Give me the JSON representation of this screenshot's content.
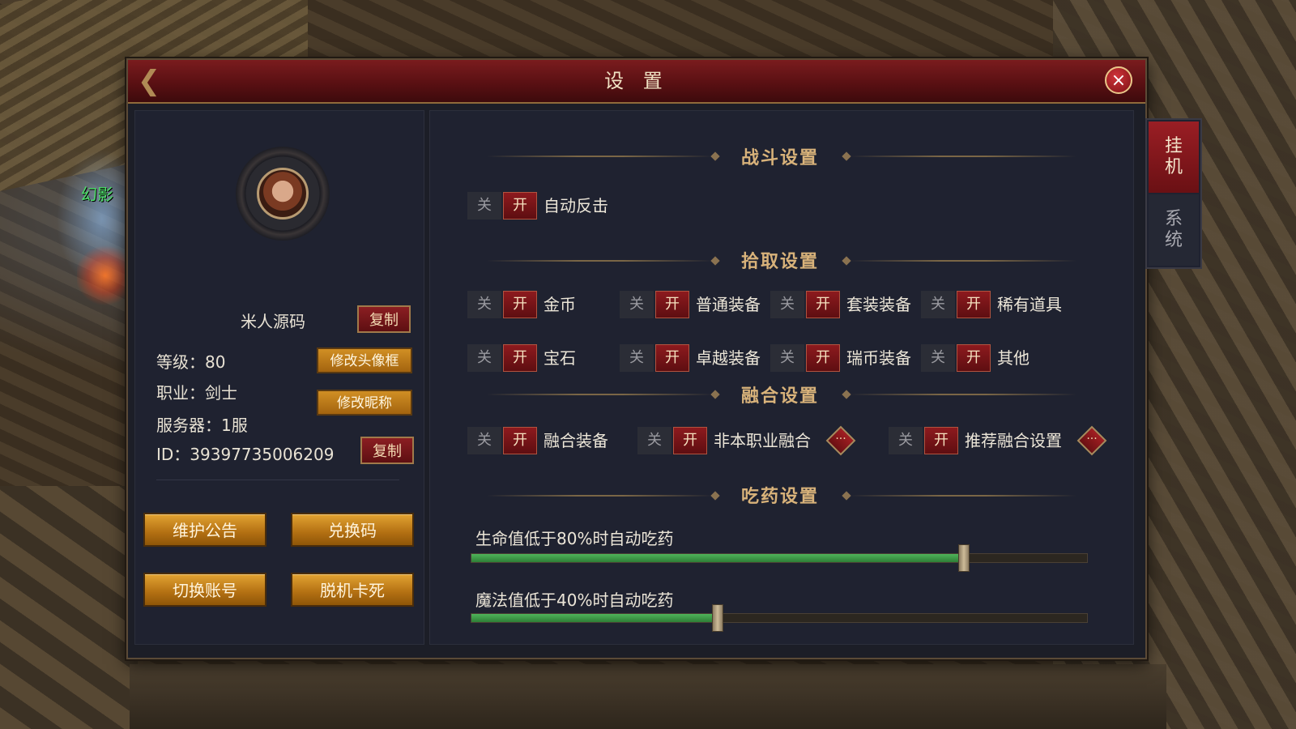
{
  "world": {
    "npc_label": "幻影"
  },
  "dialog": {
    "title": "设 置",
    "close_icon": "×"
  },
  "profile": {
    "name": "米人源码",
    "copy_name_label": "复制",
    "level_text": "等级：80",
    "class_text": "职业：剑士",
    "server_text": "服务器：1服",
    "id_text": "ID：39397735006209",
    "copy_id_label": "复制",
    "edit_frame_label": "修改头像框",
    "edit_nickname_label": "修改昵称"
  },
  "actions": {
    "maintenance": "维护公告",
    "redeem": "兑换码",
    "switch_account": "切换账号",
    "unstuck": "脱机卡死"
  },
  "toggle_labels": {
    "off": "关",
    "on": "开"
  },
  "combat": {
    "title": "战斗设置",
    "options": [
      {
        "label": "自动反击",
        "state": "on"
      }
    ]
  },
  "pickup": {
    "title": "拾取设置",
    "options": [
      {
        "label": "金币",
        "state": "on"
      },
      {
        "label": "普通装备",
        "state": "on"
      },
      {
        "label": "套装装备",
        "state": "on"
      },
      {
        "label": "稀有道具",
        "state": "on"
      },
      {
        "label": "宝石",
        "state": "on"
      },
      {
        "label": "卓越装备",
        "state": "on"
      },
      {
        "label": "瑞币装备",
        "state": "on"
      },
      {
        "label": "其他",
        "state": "on"
      }
    ]
  },
  "fusion": {
    "title": "融合设置",
    "options": [
      {
        "label": "融合装备",
        "state": "on"
      },
      {
        "label": "非本职业融合",
        "state": "on"
      },
      {
        "label": "推荐融合设置",
        "state": "on"
      }
    ],
    "more_icon": "···"
  },
  "potion": {
    "title": "吃药设置",
    "hp": {
      "label": "生命值低于80%时自动吃药",
      "value": 0.8
    },
    "mp": {
      "label": "魔法值低于40%时自动吃药",
      "value": 0.4
    }
  },
  "side_tabs": {
    "afk": "挂\n机",
    "system": "系\n统"
  },
  "colors": {
    "accent_red": "#8d1a1e",
    "gold_button": "#d18f24",
    "slider_fill": "#4fb45a",
    "section_title": "#d8b27a"
  }
}
